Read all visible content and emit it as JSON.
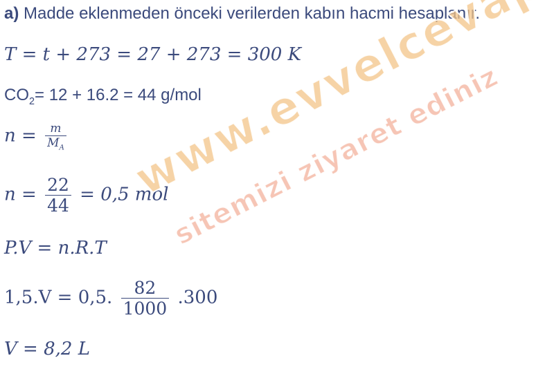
{
  "intro": {
    "label": "a)",
    "text": "Madde eklenmeden önceki verilerden kabın hacmi hesaplanır."
  },
  "eq_temperature": "T = t + 273 = 27 + 273 = 300 K",
  "eq_molar_mass": {
    "prefix": "CO",
    "sub": "2",
    "rest": "= 12 + 16.2 = 44 g/mol"
  },
  "eq_moles_formula": {
    "lhs": "n =",
    "num": "m",
    "den_main": "M",
    "den_sub": "A"
  },
  "eq_moles_value": {
    "lhs": "n =",
    "num": "22",
    "den": "44",
    "rhs": "= 0,5 mol"
  },
  "eq_gas_law": "P.V = n.R.T",
  "eq_substituted": {
    "lhs": "1,5.V = 0,5.",
    "num": "82",
    "den": "1000",
    "rhs": ".300"
  },
  "eq_result": "V = 8,2 L",
  "watermark": {
    "site": "www.evvelcevap.com",
    "slogan": "sitemizi ziyaret ediniz"
  }
}
